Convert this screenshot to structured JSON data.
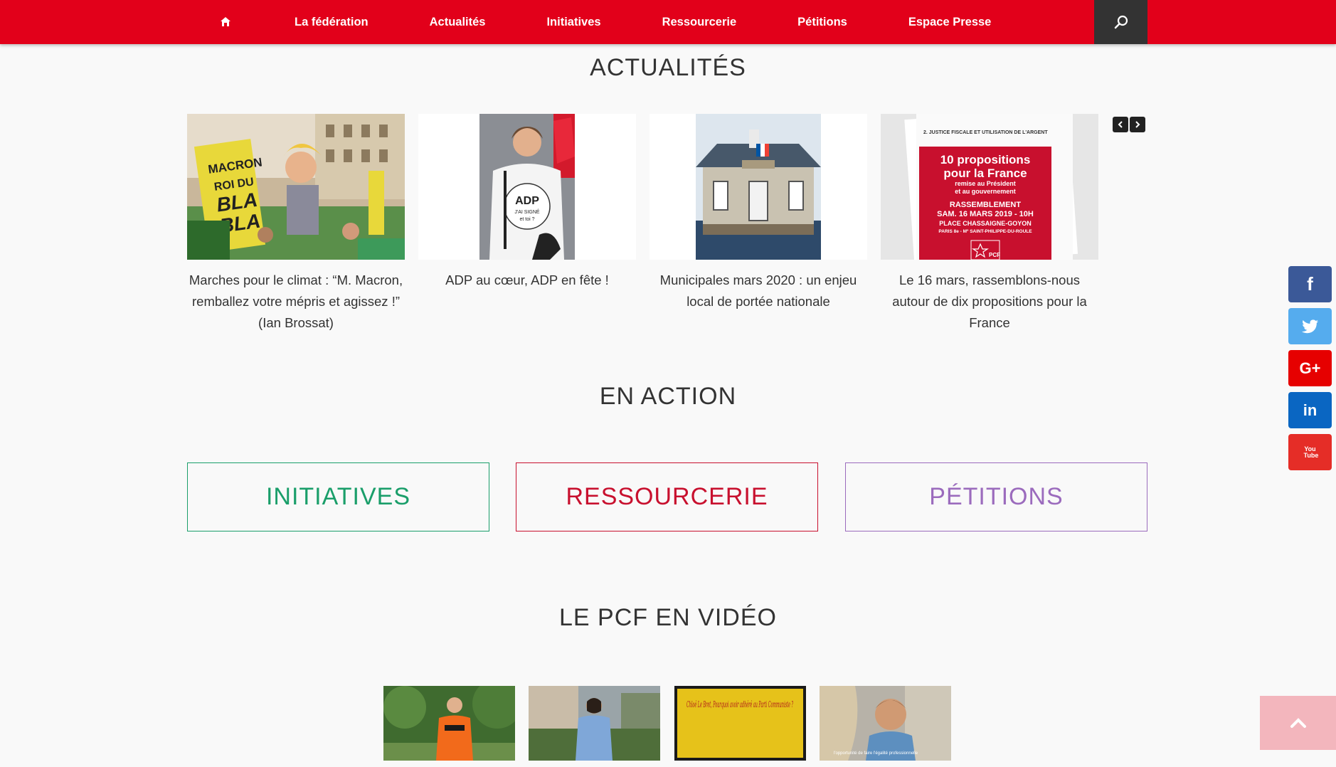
{
  "nav": {
    "home_icon": "home-icon",
    "items": [
      {
        "label": "La fédération"
      },
      {
        "label": "Actualités"
      },
      {
        "label": "Initiatives"
      },
      {
        "label": "Ressourcerie"
      },
      {
        "label": "Pétitions"
      },
      {
        "label": "Espace Presse"
      }
    ],
    "search_icon": "search-icon",
    "colors": {
      "bar": "#e2001a",
      "search_bg": "#333333"
    }
  },
  "actualites": {
    "title": "ACTUALITÉS",
    "cards": [
      {
        "text": "Marches pour le climat : “M. Macron, remballez votre mépris et agissez !” (Ian Brossat)",
        "image_sign_lines": [
          "MACRON",
          "ROI DU",
          "BLA",
          "BLA"
        ]
      },
      {
        "text": "ADP au cœur, ADP en fête !",
        "image_shirt_lines": [
          "ADP",
          "J'AI SIGNÉ",
          "et toi ?"
        ]
      },
      {
        "text": "Municipales mars 2020 : un enjeu local de portée nationale"
      },
      {
        "text": "Le 16 mars, rassemblons-nous autour de dix propositions pour la France",
        "image_poster": {
          "top": "2. JUSTICE FISCALE ET UTILISATION DE L'ARGENT",
          "line1": "10 propositions",
          "line2": "pour la France",
          "line3": "remise au Président",
          "line4": "et au gouvernement",
          "line5": "RASSEMBLEMENT",
          "line6": "SAM. 16 MARS 2019 - 10H",
          "line7": "PLACE CHASSAIGNE-GOYON",
          "line8": "PARIS 8e - Mº SAINT-PHILIPPE-DU-ROULE",
          "logo": "PCF"
        }
      }
    ]
  },
  "en_action": {
    "title": "EN ACTION",
    "boxes": [
      {
        "label": "INITIATIVES",
        "color": "#1a9e6a"
      },
      {
        "label": "RESSOURCERIE",
        "color": "#c8102e"
      },
      {
        "label": "PÉTITIONS",
        "color": "#9b6bbd"
      }
    ]
  },
  "videos": {
    "title": "LE PCF EN VIDÉO",
    "thumbs": [
      {
        "caption": ""
      },
      {
        "caption": ""
      },
      {
        "caption": "Chloé Le Bret, Pourquoi avoir adhéré au Parti Communiste ?"
      },
      {
        "caption": "l'opportunité de faire l'égalité professionnelle"
      }
    ]
  },
  "social": [
    {
      "icon": "facebook-icon",
      "glyph": "f",
      "color": "#3b5998"
    },
    {
      "icon": "twitter-icon",
      "glyph": "🐦",
      "color": "#55acee"
    },
    {
      "icon": "google-plus-icon",
      "glyph": "G+",
      "color": "#e60000"
    },
    {
      "icon": "linkedin-icon",
      "glyph": "in",
      "color": "#0a66c2"
    },
    {
      "icon": "youtube-icon",
      "glyph": "You Tube",
      "color": "#e52d27"
    }
  ],
  "back_to_top_icon": "chevron-up-icon"
}
